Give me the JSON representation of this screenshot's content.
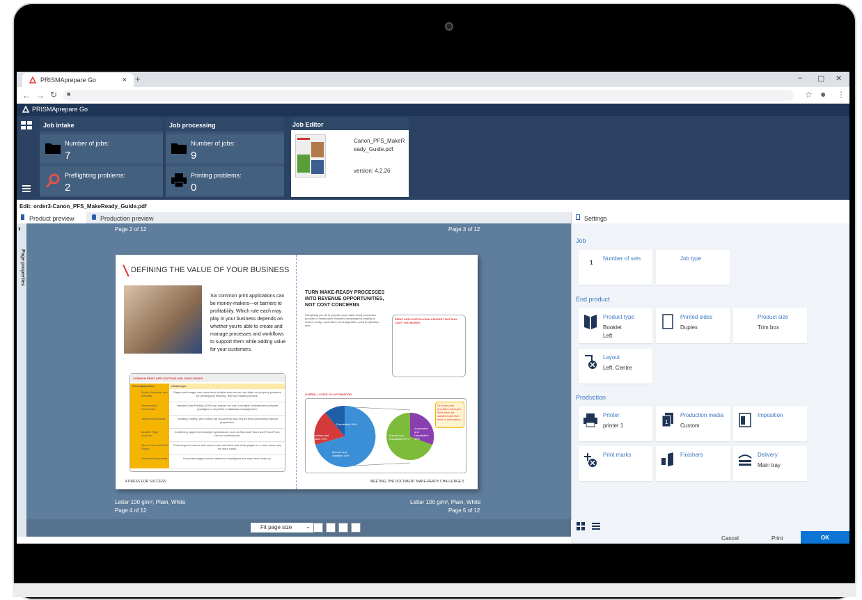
{
  "browser": {
    "tab_title": "PRISMAprepare Go",
    "tab_close": "×",
    "new_tab": "+",
    "win_min": "–",
    "win_max": "▢",
    "win_close": "✕"
  },
  "app": {
    "name": "PRISMAprepare Go",
    "job_intake": {
      "title": "Job intake",
      "jobs_label": "Number of jobs:",
      "jobs_value": "7",
      "problems_label": "Preflighting problems:",
      "problems_value": "2"
    },
    "job_processing": {
      "title": "Job processing",
      "jobs_label": "Number of jobs:",
      "jobs_value": "9",
      "problems_label": "Printing problems:",
      "problems_value": "0"
    },
    "job_editor": {
      "title": "Job Editor",
      "file_line1": "Canon_PFS_MakeR",
      "file_line2": "eady_Guide.pdf",
      "version": "version: 4.2.26"
    }
  },
  "edit": {
    "title": "Edit: order3-Canon_PFS_MakeReady_Guide.pdf",
    "tab_product": "Product preview",
    "tab_production": "Production preview",
    "side_label": "Page properties",
    "settings_tab": "Settings"
  },
  "preview": {
    "top_left": "Page 2 of 12",
    "top_right": "Page 3 of 12",
    "bottom_left_media": "Letter 100 g/m², Plain, White",
    "bottom_left_page": "Page 4 of 12",
    "bottom_right_media": "Letter 100 g/m², Plain, White",
    "bottom_right_page": "Page 5 of 12",
    "fit_label": "Fit page size"
  },
  "document": {
    "left_heading": "DEFINING THE VALUE OF YOUR BUSINESS",
    "left_body": "Six common print applications can be money-makers—or barriers to profitability. Which role each may play in your business depends on whether you're able to create and manage processes and workflows to support them while adding value for your customers.",
    "table_title": "COMMON PRINT APPLICATIONS AND CHALLENGES",
    "table_col1": "Print Application",
    "table_col2": "Challenges",
    "table_rows": [
      {
        "app": "Books, Booklets, and Manuals",
        "challenge": "Pages and images can come from multiple sources and are often not properly prepared for printing and finishing, thereby requiring rework."
      },
      {
        "app": "Personalized Documents",
        "challenge": "Variable Data Printing (VDP) can require the use of multiple, independent software packages or expertise in database management."
      },
      {
        "app": "Tabbed Documents",
        "challenge": "Creating, editing, and sorting tab documents may require time-consuming manual preparation."
      },
      {
        "app": "Multiple Page Sources",
        "challenge": "Combining pages from multiple applications, such as Microsoft Word and PowerPoint, can be cumbersome."
      },
      {
        "app": "Mixed Color and B/W Pages",
        "challenge": "Producing documents with mixed color and black and white pages on a color press may be more costly."
      },
      {
        "app": "Scanned Documents",
        "challenge": "Document pages can be skewed or misaligned and may need clean up."
      }
    ],
    "left_footer": "4   PRESS FOR SUCCESS",
    "right_heading": "TURN MAKE-READY PROCESSES INTO REVENUE OPPORTUNITIES, NOT COST CONCERNS",
    "right_body": "Everything you do to prepare your make-ready processes provides a measurable business advantage by helping to reduce costly—and often non-chargeable—print preparation time.",
    "callout_title": "PRINT APPLICATION CHALLENGES THAT MAY COST YOU MONEY",
    "chart_title": "OVERALL STATE OF AUTOMATION",
    "pie_dissatisfied": "Dissatisfied 59%",
    "pie_automated": "Automated and Satisfied 19%",
    "pie_manual": "Manual and Satisfied 19%",
    "pie2_a": "Manual and Dissatisfied 57%",
    "pie2_b": "Automated and Dissatisfied 19%",
    "orange_note": "Of those print providers surveyed, 59% were not satisfied with their level of automation.",
    "right_footer": "MEETING THE DOCUMENT MAKE-READY CHALLENGE   5"
  },
  "settings": {
    "job_section": "Job",
    "sets_value": "1",
    "sets_title": "Number of sets",
    "job_type_title": "Job type",
    "end_product_section": "End product",
    "product_type_title": "Product type",
    "product_type_v1": "Booklet",
    "product_type_v2": "Left",
    "printed_sides_title": "Printed sides",
    "printed_sides_value": "Duplex",
    "product_size_title": "Product size",
    "product_size_value": "Trim box",
    "layout_title": "Layout",
    "layout_value": "Left, Centre",
    "production_section": "Production",
    "printer_title": "Printer",
    "printer_value": "printer 1",
    "media_title": "Production media",
    "media_value": "Custom",
    "imposition_title": "Imposition",
    "print_marks_title": "Print marks",
    "finishers_title": "Finishers",
    "delivery_title": "Delivery",
    "delivery_value": "Main tray"
  },
  "footer": {
    "cancel": "Cancel",
    "print": "Print",
    "ok": "OK"
  },
  "colors": {
    "navy": "#1f3555",
    "accent": "#3b78c2",
    "ok": "#0b74d4"
  }
}
